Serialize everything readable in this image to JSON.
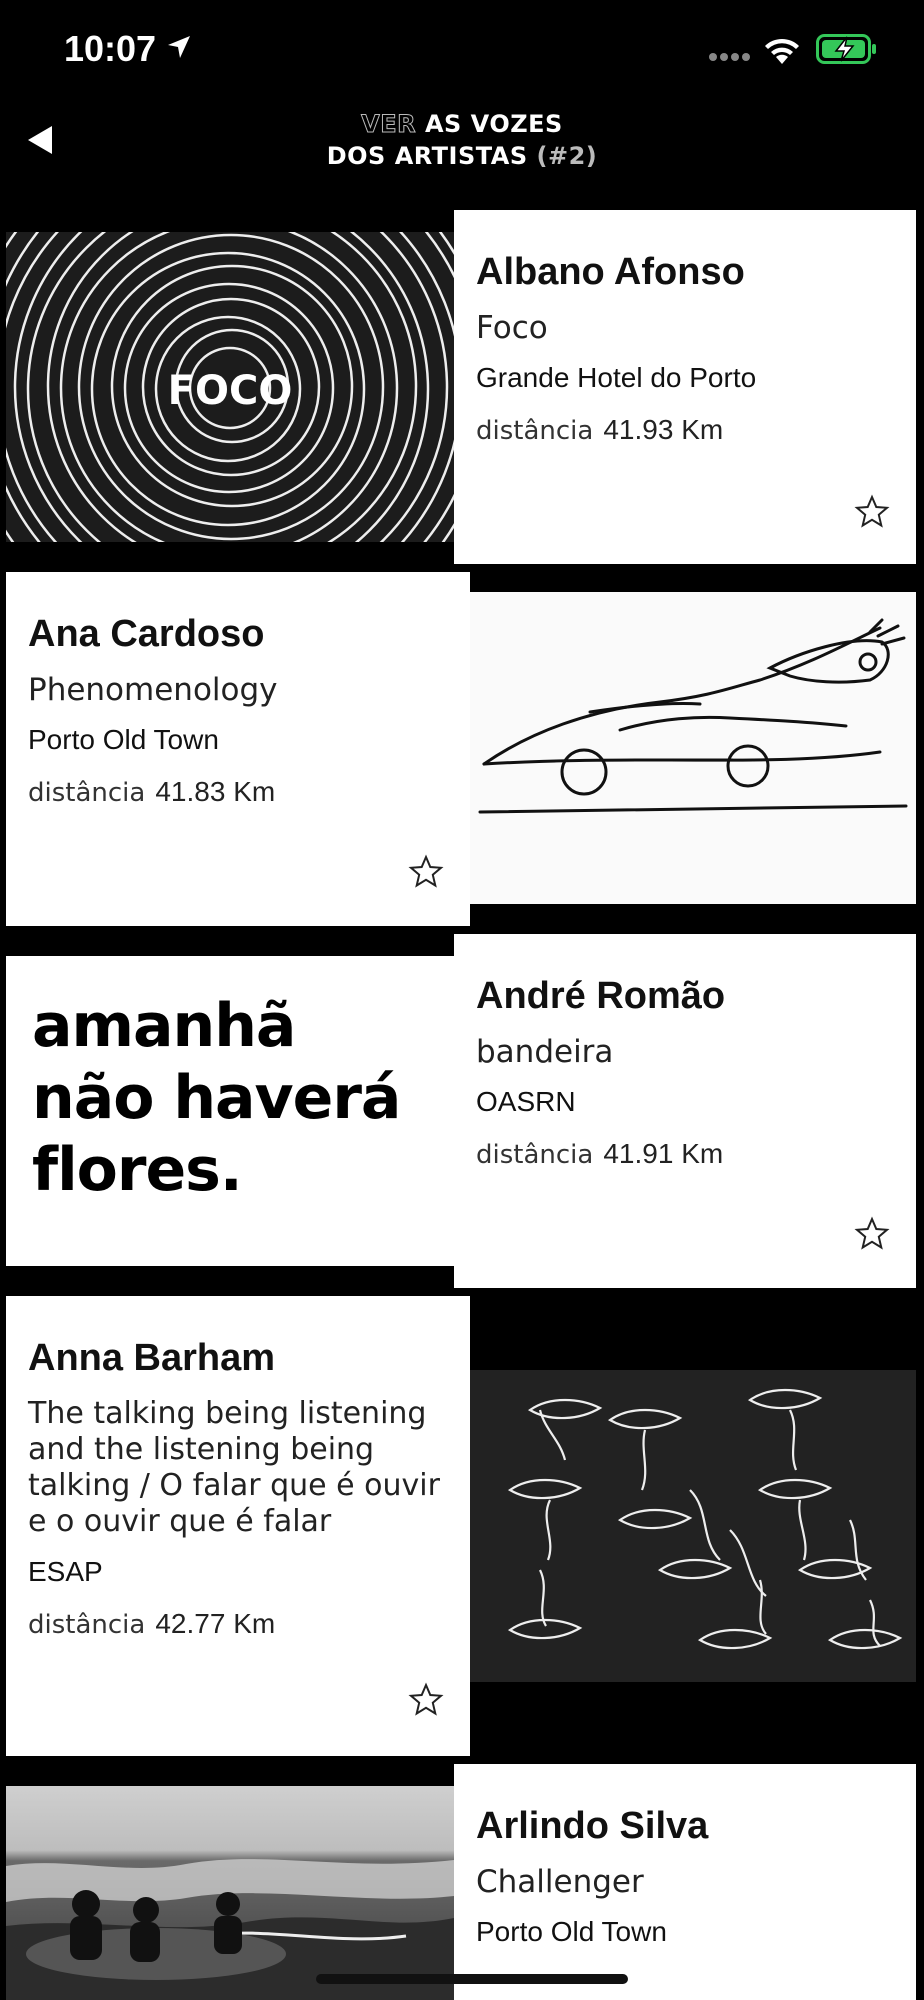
{
  "status": {
    "time": "10:07"
  },
  "nav": {
    "title_dim": "VER",
    "title_line1": " AS VOZES",
    "title_line2": "DOS ARTISTAS",
    "title_tag": " (#2)"
  },
  "colors": {
    "background": "#000000",
    "card": "#ffffff",
    "battery": "#34c759"
  },
  "entries": [
    {
      "artist": "Albano Afonso",
      "work": "Foco",
      "place": "Grande Hotel do Porto",
      "distance_label": "distância",
      "distance": "41.93 Km",
      "image_text": "FOCO",
      "icon": "star-outline-icon"
    },
    {
      "artist": "Ana Cardoso",
      "work": "Phenomenology",
      "place": "Porto Old Town",
      "distance_label": "distância",
      "distance": "41.83 Km",
      "icon": "star-outline-icon"
    },
    {
      "artist": "André Romão",
      "work": "bandeira",
      "place": "OASRN",
      "distance_label": "distância",
      "distance": "41.91 Km",
      "image_text": [
        "amanhã",
        "não haverá",
        "flores."
      ],
      "icon": "star-outline-icon"
    },
    {
      "artist": "Anna Barham",
      "work": "The talking being listening and the listening being talking / O falar que é ouvir e o ouvir que é falar",
      "place": "ESAP",
      "distance_label": "distância",
      "distance": "42.77 Km",
      "icon": "star-outline-icon"
    },
    {
      "artist": "Arlindo Silva",
      "work": "Challenger",
      "place": "Porto Old Town",
      "icon": "star-outline-icon"
    }
  ]
}
